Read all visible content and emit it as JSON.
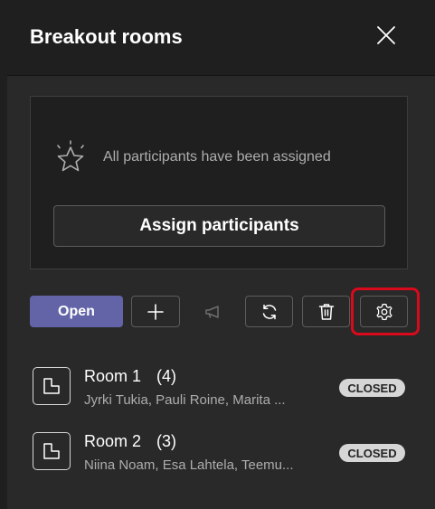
{
  "header": {
    "title": "Breakout rooms",
    "close_icon": "close-icon"
  },
  "assign_card": {
    "icon": "sparkle-star-icon",
    "message": "All participants have been assigned",
    "button_label": "Assign participants"
  },
  "toolbar": {
    "open_label": "Open",
    "add_icon": "plus-icon",
    "announce_icon": "megaphone-icon",
    "recreate_icon": "refresh-icon",
    "delete_icon": "trash-icon",
    "settings_icon": "gear-icon",
    "highlight_color": "#d90a1b"
  },
  "rooms": [
    {
      "name": "Room 1",
      "count": "(4)",
      "members": "Jyrki Tukia, Pauli Roine, Marita ...",
      "status": "CLOSED"
    },
    {
      "name": "Room 2",
      "count": "(3)",
      "members": "Niina Noam, Esa Lahtela, Teemu...",
      "status": "CLOSED"
    }
  ],
  "colors": {
    "background": "#292929",
    "header_background": "#1f1f1f",
    "primary": "#6264a7",
    "badge_background": "#d6d6d6"
  }
}
